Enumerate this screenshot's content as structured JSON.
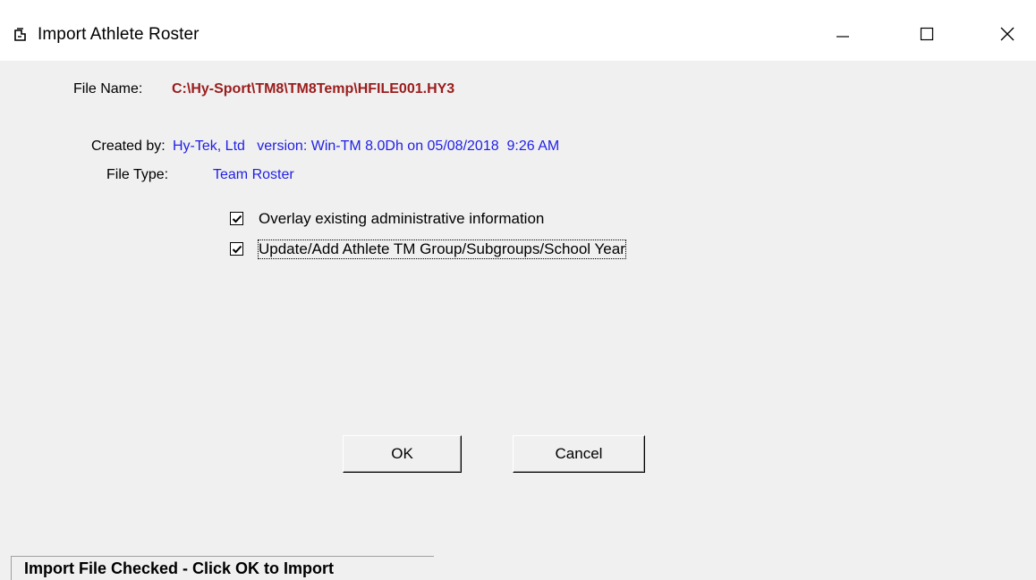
{
  "window": {
    "title": "Import Athlete Roster",
    "controls": {
      "minimize": "minimize-icon",
      "maximize": "maximize-icon",
      "close": "close-icon"
    }
  },
  "file": {
    "name_label": "File Name:",
    "name_value": "C:\\Hy-Sport\\TM8\\TM8Temp\\HFILE001.HY3",
    "created_by_label": "Created by:",
    "created_by_value": "Hy-Tek, Ltd   version: Win-TM 8.0Dh on 05/08/2018  9:26 AM",
    "type_label": "File Type:",
    "type_value": "Team Roster"
  },
  "options": [
    {
      "label": "Overlay existing administrative information",
      "checked": true
    },
    {
      "label": "Update/Add Athlete TM Group/Subgroups/School Year",
      "checked": true
    }
  ],
  "buttons": {
    "ok": "OK",
    "cancel": "Cancel"
  },
  "status": "Import File Checked - Click OK to Import",
  "colors": {
    "file_name": "#9b1c1c",
    "info_value": "#1f1fe6",
    "background": "#f0f0f0"
  }
}
